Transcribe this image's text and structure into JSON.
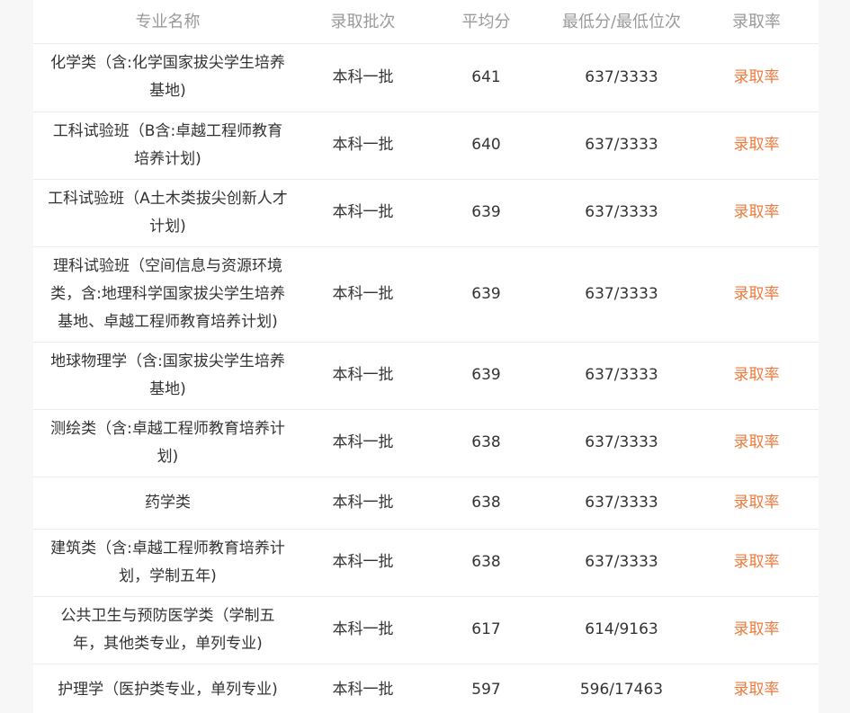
{
  "table": {
    "headers": [
      "专业名称",
      "录取批次",
      "平均分",
      "最低分/最低位次",
      "录取率"
    ],
    "rows": [
      {
        "major": "化学类（含:化学国家拔尖学生培养基地)",
        "batch": "本科一批",
        "avg": "641",
        "min": "637/3333",
        "rate": "录取率"
      },
      {
        "major": "工科试验班（B含:卓越工程师教育培养计划)",
        "batch": "本科一批",
        "avg": "640",
        "min": "637/3333",
        "rate": "录取率"
      },
      {
        "major": "工科试验班（A土木类拔尖创新人才计划)",
        "batch": "本科一批",
        "avg": "639",
        "min": "637/3333",
        "rate": "录取率"
      },
      {
        "major": "理科试验班（空间信息与资源环境类，含:地理科学国家拔尖学生培养基地、卓越工程师教育培养计划)",
        "batch": "本科一批",
        "avg": "639",
        "min": "637/3333",
        "rate": "录取率"
      },
      {
        "major": "地球物理学（含:国家拔尖学生培养基地)",
        "batch": "本科一批",
        "avg": "639",
        "min": "637/3333",
        "rate": "录取率"
      },
      {
        "major": "测绘类（含:卓越工程师教育培养计划)",
        "batch": "本科一批",
        "avg": "638",
        "min": "637/3333",
        "rate": "录取率"
      },
      {
        "major": "药学类",
        "batch": "本科一批",
        "avg": "638",
        "min": "637/3333",
        "rate": "录取率"
      },
      {
        "major": "建筑类（含:卓越工程师教育培养计划，学制五年)",
        "batch": "本科一批",
        "avg": "638",
        "min": "637/3333",
        "rate": "录取率"
      },
      {
        "major": "公共卫生与预防医学类（学制五年，其他类专业，单列专业)",
        "batch": "本科一批",
        "avg": "617",
        "min": "614/9163",
        "rate": "录取率"
      },
      {
        "major": "护理学（医护类专业，单列专业)",
        "batch": "本科一批",
        "avg": "597",
        "min": "596/17463",
        "rate": "录取率"
      }
    ]
  },
  "colors": {
    "header_text": "#9a9a9a",
    "body_text": "#333333",
    "link": "#f07a3d",
    "divider": "#ececec"
  }
}
